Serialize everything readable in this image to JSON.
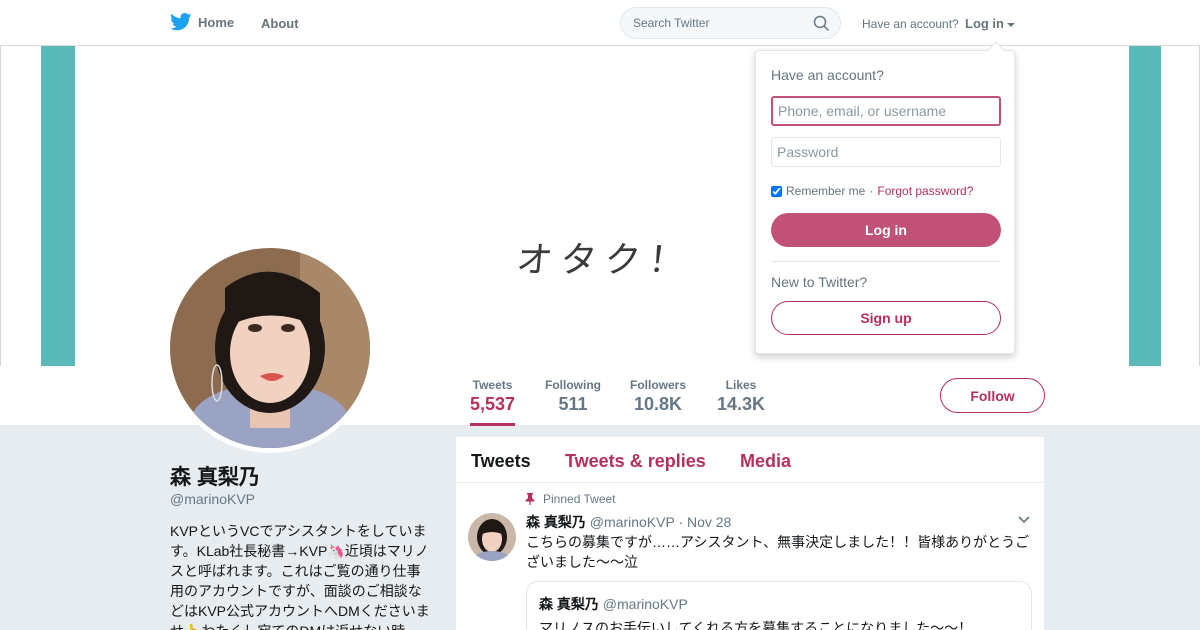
{
  "nav": {
    "home_label": "Home",
    "about_label": "About",
    "search_placeholder": "Search Twitter",
    "have_account_text": "Have an account?",
    "login_label": "Log in",
    "brand_color": "#1da1f2"
  },
  "banner": {
    "text": "オタク！",
    "strip_color": "#5bb9b7"
  },
  "stats": [
    {
      "label": "Tweets",
      "value": "5,537"
    },
    {
      "label": "Following",
      "value": "511"
    },
    {
      "label": "Followers",
      "value": "10.8K"
    },
    {
      "label": "Likes",
      "value": "14.3K"
    }
  ],
  "follow_label": "Follow",
  "accent_color": "#b5305e",
  "profile": {
    "name": "森 真梨乃",
    "handle": "@marinoKVP",
    "bio": "KVPというVCでアシスタントをしています。KLab社長秘書→KVP🦄近頃はマリノスと呼ばれます。これはご覧の通り仕事用のアカウントですが、面談のご相談などはKVP公式アカウントへDMくださいませ👆わたくし宛てのDMは返せない時"
  },
  "timeline": {
    "tabs": [
      "Tweets",
      "Tweets & replies",
      "Media"
    ],
    "pinned_label": "Pinned Tweet",
    "tweet": {
      "name": "森 真梨乃",
      "handle": "@marinoKVP",
      "date": "· Nov 28",
      "text": "こちらの募集ですが……アシスタント、無事決定しました！！皆様ありがとうございました～～泣",
      "quote": {
        "name": "森 真梨乃",
        "handle": "@marinoKVP",
        "text": "マリノスのお手伝いしてくれる方を募集することになりました～～！"
      }
    }
  },
  "login_dropdown": {
    "title": "Have an account?",
    "username_placeholder": "Phone, email, or username",
    "password_placeholder": "Password",
    "remember_label": "Remember me",
    "separator": "·",
    "forgot_label": "Forgot password?",
    "login_button": "Log in",
    "new_text": "New to Twitter?",
    "signup_button": "Sign up"
  }
}
